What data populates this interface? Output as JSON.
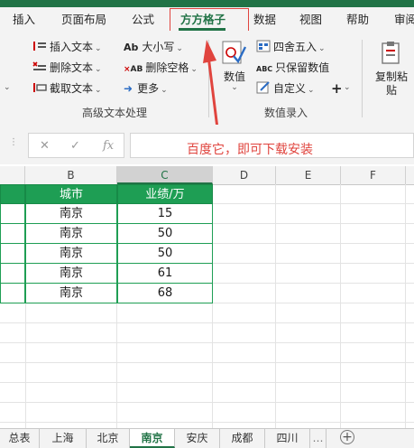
{
  "ribbon_tabs": [
    "插入",
    "页面布局",
    "公式",
    "方方格子",
    "数据",
    "视图",
    "帮助",
    "审阅"
  ],
  "ribbon": {
    "insert_text": "插入文本",
    "delete_text": "删除文本",
    "cut_text": "截取文本",
    "case": "大小写",
    "delete_spaces": "删除空格",
    "more": "更多",
    "numeric": "数值",
    "round": "四舍五入",
    "keep_numeric": "只保留数值",
    "custom": "自定义",
    "plus": "+",
    "copy_paste_1": "复制粘",
    "copy_paste_2": "贴",
    "group_advanced_text": "高级文本处理",
    "group_numeric_entry": "数值录入"
  },
  "formula_bar": {
    "cancel": "✕",
    "enter": "✓",
    "fx": "fx",
    "value": ""
  },
  "overlay_text": "百度它，即可下载安装",
  "columns": [
    "B",
    "C",
    "D",
    "E",
    "F"
  ],
  "table": {
    "headers": [
      "城市",
      "业绩/万"
    ],
    "rows": [
      [
        "南京",
        "15"
      ],
      [
        "南京",
        "50"
      ],
      [
        "南京",
        "50"
      ],
      [
        "南京",
        "61"
      ],
      [
        "南京",
        "68"
      ]
    ]
  },
  "sheets": [
    "总表",
    "上海",
    "北京",
    "南京",
    "安庆",
    "成都",
    "四川"
  ],
  "active_sheet": "南京",
  "colors": {
    "accent": "#217346",
    "header_fill": "#1e9e54",
    "annotation": "#e0443e"
  }
}
